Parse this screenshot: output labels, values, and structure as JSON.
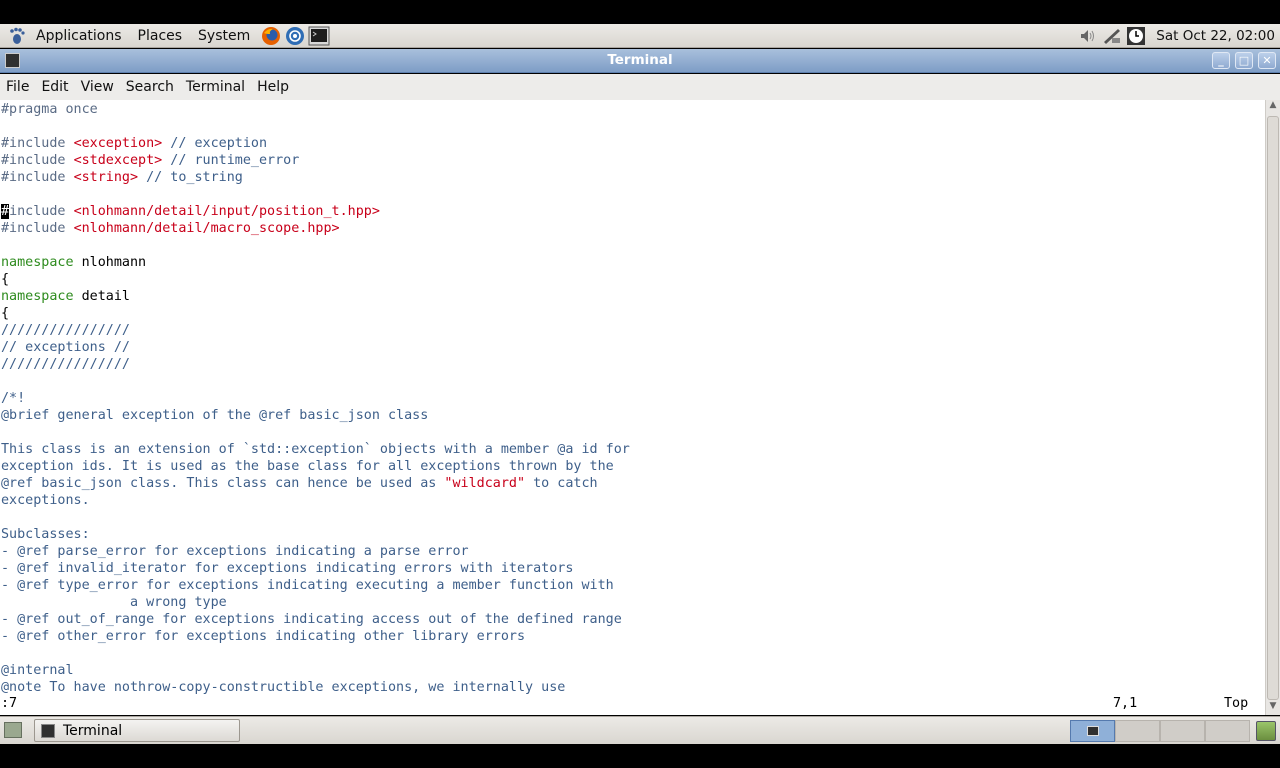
{
  "top_panel": {
    "menus": [
      "Applications",
      "Places",
      "System"
    ],
    "clock": "Sat Oct 22, 02:00"
  },
  "window": {
    "title": "Terminal"
  },
  "menubar": {
    "items": [
      "File",
      "Edit",
      "View",
      "Search",
      "Terminal",
      "Help"
    ]
  },
  "editor": {
    "lines": [
      [
        {
          "t": "#pragma once",
          "c": "pp"
        }
      ],
      [],
      [
        {
          "t": "#include ",
          "c": "pp"
        },
        {
          "t": "<exception>",
          "c": "ang"
        },
        {
          "t": " // exception",
          "c": "cm"
        }
      ],
      [
        {
          "t": "#include ",
          "c": "pp"
        },
        {
          "t": "<stdexcept>",
          "c": "ang"
        },
        {
          "t": " // runtime_error",
          "c": "cm"
        }
      ],
      [
        {
          "t": "#include ",
          "c": "pp"
        },
        {
          "t": "<string>",
          "c": "ang"
        },
        {
          "t": " // to_string",
          "c": "cm"
        }
      ],
      [],
      [
        {
          "t": "#",
          "c": "cursor"
        },
        {
          "t": "include ",
          "c": "pp"
        },
        {
          "t": "<nlohmann/detail/input/position_t.hpp>",
          "c": "ang"
        }
      ],
      [
        {
          "t": "#include ",
          "c": "pp"
        },
        {
          "t": "<nlohmann/detail/macro_scope.hpp>",
          "c": "ang"
        }
      ],
      [],
      [
        {
          "t": "namespace",
          "c": "kw"
        },
        {
          "t": " nlohmann",
          "c": "plain"
        }
      ],
      [
        {
          "t": "{",
          "c": "plain"
        }
      ],
      [
        {
          "t": "namespace",
          "c": "kw"
        },
        {
          "t": " detail",
          "c": "plain"
        }
      ],
      [
        {
          "t": "{",
          "c": "plain"
        }
      ],
      [
        {
          "t": "////////////////",
          "c": "cm"
        }
      ],
      [
        {
          "t": "// exceptions //",
          "c": "cm"
        }
      ],
      [
        {
          "t": "////////////////",
          "c": "cm"
        }
      ],
      [],
      [
        {
          "t": "/*!",
          "c": "cm"
        }
      ],
      [
        {
          "t": "@brief general exception of the @ref basic_json class",
          "c": "cm"
        }
      ],
      [],
      [
        {
          "t": "This class is an extension of `std::exception` objects with a member @a id for",
          "c": "cm"
        }
      ],
      [
        {
          "t": "exception ids. It is used as the base class for all exceptions thrown by the",
          "c": "cm"
        }
      ],
      [
        {
          "t": "@ref basic_json class. This class can hence be used as ",
          "c": "cm"
        },
        {
          "t": "\"wildcard\"",
          "c": "str"
        },
        {
          "t": " to catch",
          "c": "cm"
        }
      ],
      [
        {
          "t": "exceptions.",
          "c": "cm"
        }
      ],
      [],
      [
        {
          "t": "Subclasses:",
          "c": "cm"
        }
      ],
      [
        {
          "t": "- @ref parse_error for exceptions indicating a parse error",
          "c": "cm"
        }
      ],
      [
        {
          "t": "- @ref invalid_iterator for exceptions indicating errors with iterators",
          "c": "cm"
        }
      ],
      [
        {
          "t": "- @ref type_error for exceptions indicating executing a member function with",
          "c": "cm"
        }
      ],
      [
        {
          "t": "                a wrong type",
          "c": "cm"
        }
      ],
      [
        {
          "t": "- @ref out_of_range for exceptions indicating access out of the defined range",
          "c": "cm"
        }
      ],
      [
        {
          "t": "- @ref other_error for exceptions indicating other library errors",
          "c": "cm"
        }
      ],
      [],
      [
        {
          "t": "@internal",
          "c": "cm"
        }
      ],
      [
        {
          "t": "@note To have nothrow-copy-constructible exceptions, we internally use",
          "c": "cm"
        }
      ]
    ],
    "status_left": ":7",
    "status_pos": "7,1",
    "status_scroll": "Top"
  },
  "taskbar": {
    "task_label": "Terminal"
  }
}
